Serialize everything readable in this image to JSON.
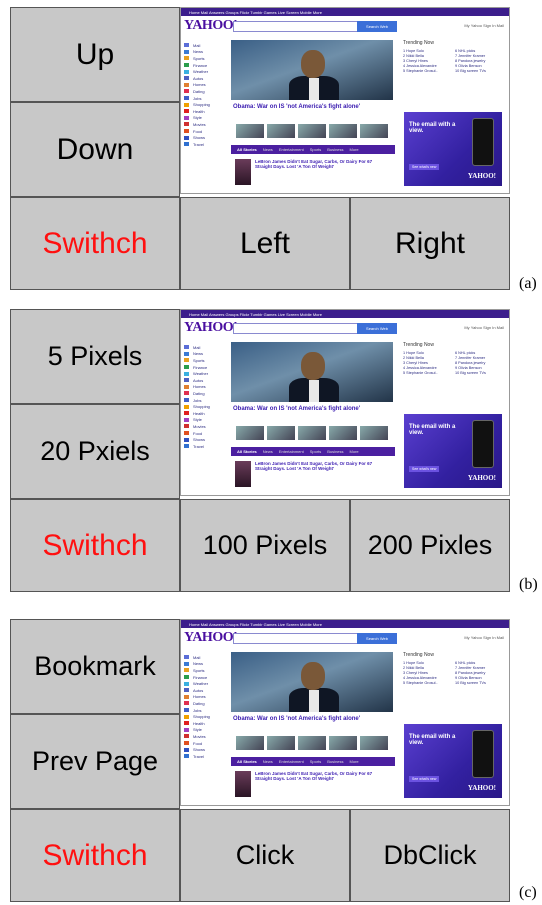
{
  "panels": [
    {
      "label": "(a)",
      "buttons": {
        "top": "Up",
        "mid": "Down",
        "switch": "Swithch",
        "b1": "Left",
        "b2": "Right"
      }
    },
    {
      "label": "(b)",
      "buttons": {
        "top": "5 Pixels",
        "mid": "20 Pxiels",
        "switch": "Swithch",
        "b1": "100 Pixels",
        "b2": "200 Pixles"
      }
    },
    {
      "label": "(c)",
      "buttons": {
        "top": "Bookmark",
        "mid": "Prev Page",
        "switch": "Swithch",
        "b1": "Click",
        "b2": "DbClick"
      }
    }
  ],
  "screenshot": {
    "topbar": "Home   Mail   Answers   Groups   Flickr   Tumblr   Games   Live   Screen   Mobile   More",
    "logo": "YAHOO!",
    "search_button": "Search Web",
    "signin": "My Yahoo   Sign In   Mail",
    "sidenav": [
      "Mail",
      "News",
      "Sports",
      "Finance",
      "Weather",
      "Autos",
      "Homes",
      "Dating",
      "Jobs",
      "Shopping",
      "Health",
      "Style",
      "Movies",
      "Food",
      "Shows",
      "Travel"
    ],
    "headline": "Obama: War on IS 'not America's fight alone'",
    "tabs": [
      "All Stories",
      "News",
      "Entertainment",
      "Sports",
      "Business",
      "More"
    ],
    "story": "LeBron James Didn't Eat Sugar, Carbs, Or Dairy For 67 Straight Days. Lost 'A Ton Of Weight'",
    "trending_title": "Trending Now",
    "trending": [
      [
        "1 Hope Solo",
        "6 NHL picks"
      ],
      [
        "2 Nikki Bella",
        "7 Jennifer Kramer"
      ],
      [
        "3 Cheryl Hines",
        "8 Pandora jewelry"
      ],
      [
        "4 Jessica Alexandre",
        "9 Olivia Benson"
      ],
      [
        "5 Stephanie Grosul..",
        "10 Big screen TVs"
      ]
    ],
    "ad_title": "The email with a view.",
    "ad_button": "See what's new",
    "ad_brand": "YAHOO!"
  }
}
